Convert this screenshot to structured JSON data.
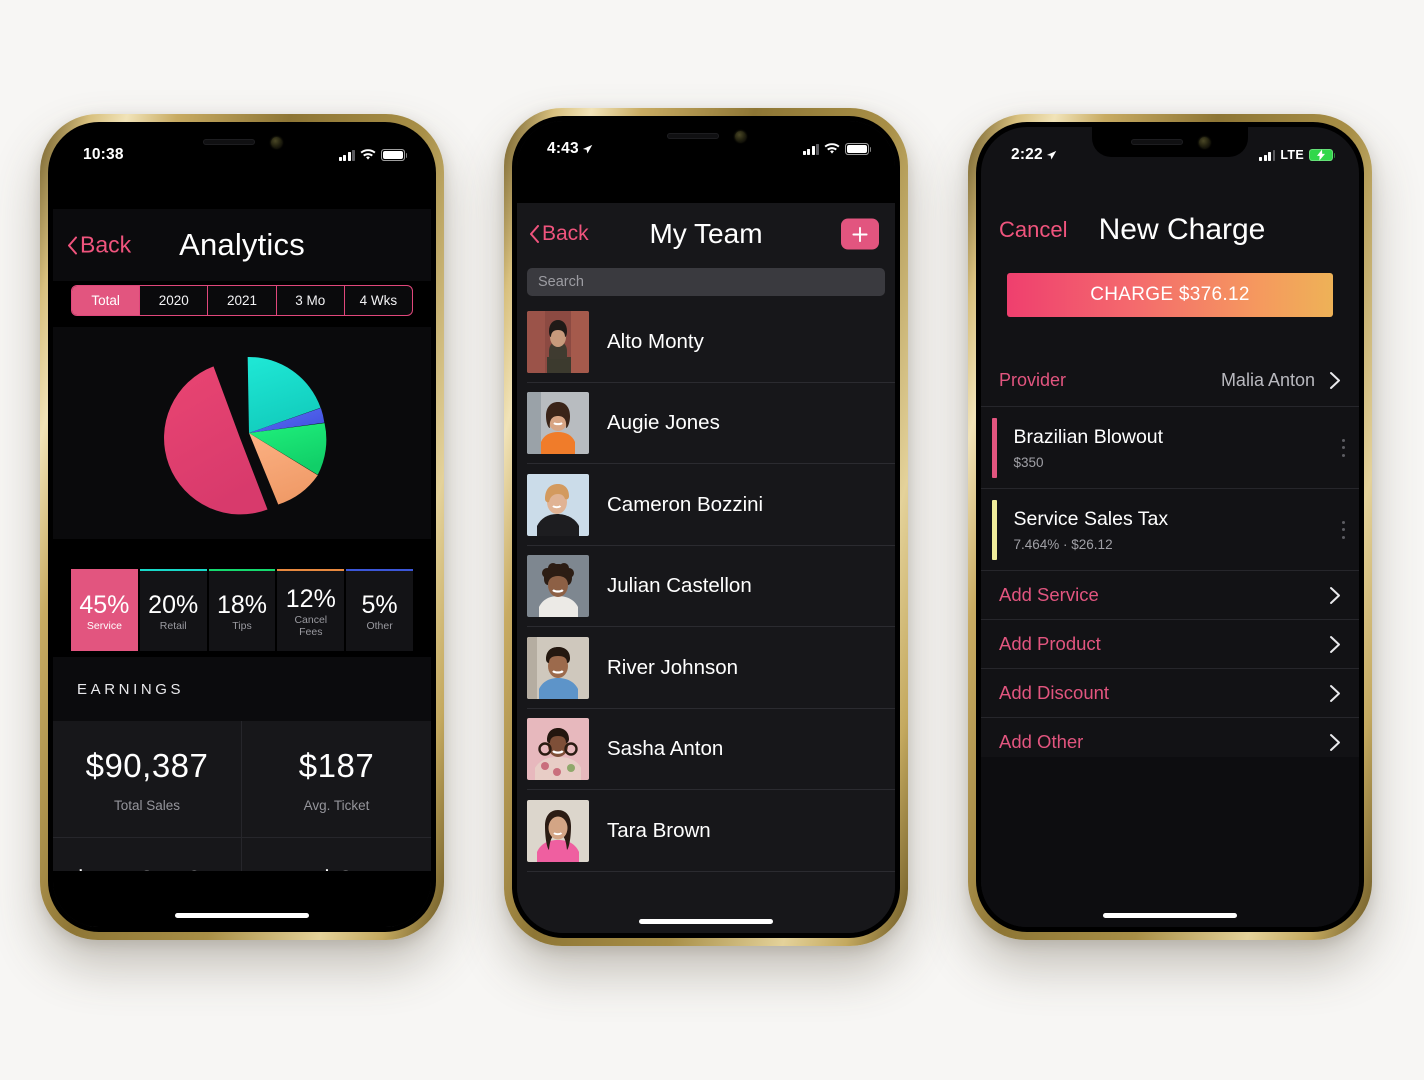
{
  "theme": {
    "accent_pink": "#e2557f",
    "accent_pink_text": "#f0547d",
    "bg_black": "#000000",
    "bg_dark": "#17171a",
    "bezel_gold": "#c4a95f"
  },
  "phones": [
    {
      "id": "analytics",
      "status_bar": {
        "time": "10:38",
        "carrier": "",
        "battery_icon": "battery-full-icon",
        "wifi_icon": "wifi-icon",
        "signal_icon": "cellular-bars-icon"
      },
      "nav": {
        "back_label": "Back",
        "title": "Analytics"
      },
      "segmented_control": {
        "options": [
          "Total",
          "2020",
          "2021",
          "3 Mo",
          "4 Wks"
        ],
        "selected": "Total"
      },
      "stat_cards": [
        {
          "pct": "45%",
          "label": "Service",
          "color": "#e2557f",
          "selected": true
        },
        {
          "pct": "20%",
          "label": "Retail",
          "color": "#18d8c8",
          "selected": false
        },
        {
          "pct": "18%",
          "label": "Tips",
          "color": "#15d96e",
          "selected": false
        },
        {
          "pct": "12%",
          "label": "Cancel\nFees",
          "color": "#e8893f",
          "selected": false
        },
        {
          "pct": "5%",
          "label": "Other",
          "color": "#3b56d8",
          "selected": false
        }
      ],
      "earnings": {
        "section_label": "EARNINGS",
        "cells": [
          {
            "value": "$90,387",
            "label": "Total Sales"
          },
          {
            "value": "$187",
            "label": "Avg. Ticket"
          }
        ]
      }
    },
    {
      "id": "my-team",
      "status_bar": {
        "time": "4:43",
        "location_icon": "location-arrow-icon",
        "battery_icon": "battery-full-icon",
        "wifi_icon": "wifi-icon",
        "signal_icon": "cellular-bars-icon"
      },
      "nav": {
        "back_label": "Back",
        "title": "My Team",
        "add_icon": "plus-icon"
      },
      "search": {
        "placeholder": "Search",
        "value": ""
      },
      "members": [
        {
          "name": "Alto Monty",
          "avatar_bg": "#8c4a42",
          "avatar_accent": "#3c3a2e"
        },
        {
          "name": "Augie Jones",
          "avatar_bg": "#b8bcc0",
          "avatar_accent": "#f07c2a"
        },
        {
          "name": "Cameron Bozzini",
          "avatar_bg": "#c9dbe8",
          "avatar_accent": "#d39a5e"
        },
        {
          "name": "Julian Castellon",
          "avatar_bg": "#7e8790",
          "avatar_accent": "#2c1d14"
        },
        {
          "name": "River Johnson",
          "avatar_bg": "#cfc8bd",
          "avatar_accent": "#5d94c9"
        },
        {
          "name": "Sasha Anton",
          "avatar_bg": "#e7b8bd",
          "avatar_accent": "#3a241d"
        },
        {
          "name": "Tara Brown",
          "avatar_bg": "#dcd6cc",
          "avatar_accent": "#ef5fa0"
        }
      ]
    },
    {
      "id": "new-charge",
      "status_bar": {
        "time": "2:22",
        "location_icon": "location-arrow-icon",
        "carrier": "LTE",
        "battery_icon": "battery-charging-icon",
        "signal_icon": "cellular-bars-icon"
      },
      "nav": {
        "cancel_label": "Cancel",
        "title": "New Charge"
      },
      "charge_button": {
        "label": "CHARGE $376.12",
        "gradient_from": "#ef3f6e",
        "gradient_to": "#eeb257"
      },
      "provider": {
        "label": "Provider",
        "value": "Malia Anton",
        "chevron_icon": "chevron-right-icon"
      },
      "line_items": [
        {
          "title": "Brazilian Blowout",
          "subtitle": "$350",
          "bar_color": "#e2557f",
          "menu_icon": "more-vertical-icon"
        },
        {
          "title": "Service Sales Tax",
          "subtitle": "7.464% · $26.12",
          "bar_color": "#f0ec9a",
          "menu_icon": "more-vertical-icon"
        }
      ],
      "add_rows": [
        {
          "label": "Add Service",
          "chevron_icon": "chevron-right-icon"
        },
        {
          "label": "Add Product",
          "chevron_icon": "chevron-right-icon"
        },
        {
          "label": "Add Discount",
          "chevron_icon": "chevron-right-icon"
        },
        {
          "label": "Add Other",
          "chevron_icon": "chevron-right-icon"
        }
      ]
    }
  ],
  "chart_data": {
    "type": "pie",
    "title": "Analytics breakdown",
    "categories": [
      "Service",
      "Retail",
      "Tips",
      "Cancel Fees",
      "Other"
    ],
    "values": [
      45,
      20,
      18,
      12,
      5
    ],
    "unit": "percent",
    "colors": [
      "#e2557f",
      "#18d8c8",
      "#15d96e",
      "#f5a86e",
      "#4a5fe0"
    ],
    "exploded_slice": "Service",
    "legend_position": "bottom",
    "grid": false
  }
}
